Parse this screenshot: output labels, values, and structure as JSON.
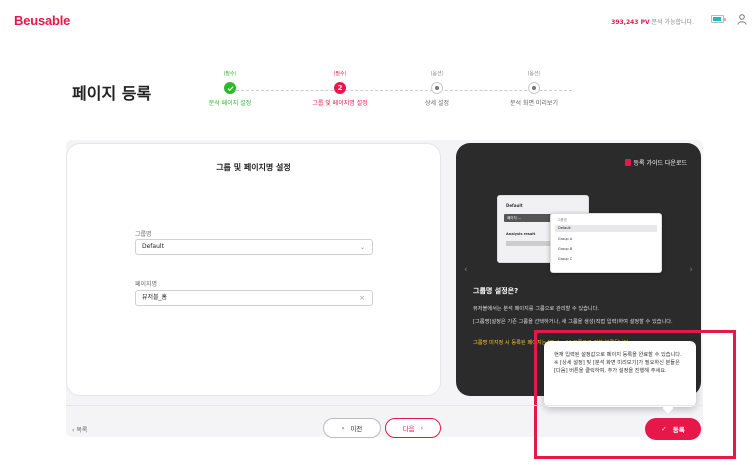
{
  "header": {
    "logo": "Beusable",
    "pv_count": "393,243 PV",
    "pv_text": " 분석 가능합니다.",
    "battery_level": 0.7
  },
  "page": {
    "title": "페이지 등록"
  },
  "steps": [
    {
      "tag": "(필수)",
      "number": "",
      "name": "분석 페이지 설정",
      "state": "done"
    },
    {
      "tag": "(필수)",
      "number": "2",
      "name": "그룹 및 페이지명 설정",
      "state": "active"
    },
    {
      "tag": "(옵션)",
      "number": "",
      "name": "상세 설정",
      "state": "todo"
    },
    {
      "tag": "(옵션)",
      "number": "",
      "name": "분석 화면 미리보기",
      "state": "todo"
    }
  ],
  "form": {
    "title": "그룹 및 페이지명 설정",
    "group_label": "그룹명",
    "group_value": "Default",
    "page_label": "페이지명",
    "page_value": "뷰저블_홈"
  },
  "guide": {
    "download": "등록 가이드 다운로드",
    "mock": {
      "title": "Default",
      "bar": "페이지 ...",
      "analysis": "Analysis result",
      "group_label": "그룹명",
      "options": [
        "Default",
        "Group A",
        "Group B",
        "Group C"
      ]
    },
    "heading": "그룹명 설정은?",
    "desc1": "뷰저블에서는 분석 페이지를 그룹으로 관리할 수 있습니다.",
    "desc2": "[그룹명]설정은 기존 그룹을 선택하거나, 새 그룹을 생성(직접 입력)하여 설정할 수 있습니다.",
    "note": "그룹명 미지정 시 등록된 페이지는 [Default] 그룹으로 기본 분류됩니다."
  },
  "tooltip": {
    "line1": "현재 입력된 설정값으로 페이지 등록을 완료할 수 있습니다.",
    "line2": "※ [상세 설정] 및 [분석 화면 미리보기]가 필요하신 분들은 [다음] 버튼을 클릭하여, 추가 설정을 진행해 주세요."
  },
  "footer": {
    "list": "목록",
    "prev": "이전",
    "next": "다음",
    "register": "등록"
  },
  "colors": {
    "brand": "#e8174a",
    "done": "#2db82d",
    "note": "#f6c12c"
  }
}
